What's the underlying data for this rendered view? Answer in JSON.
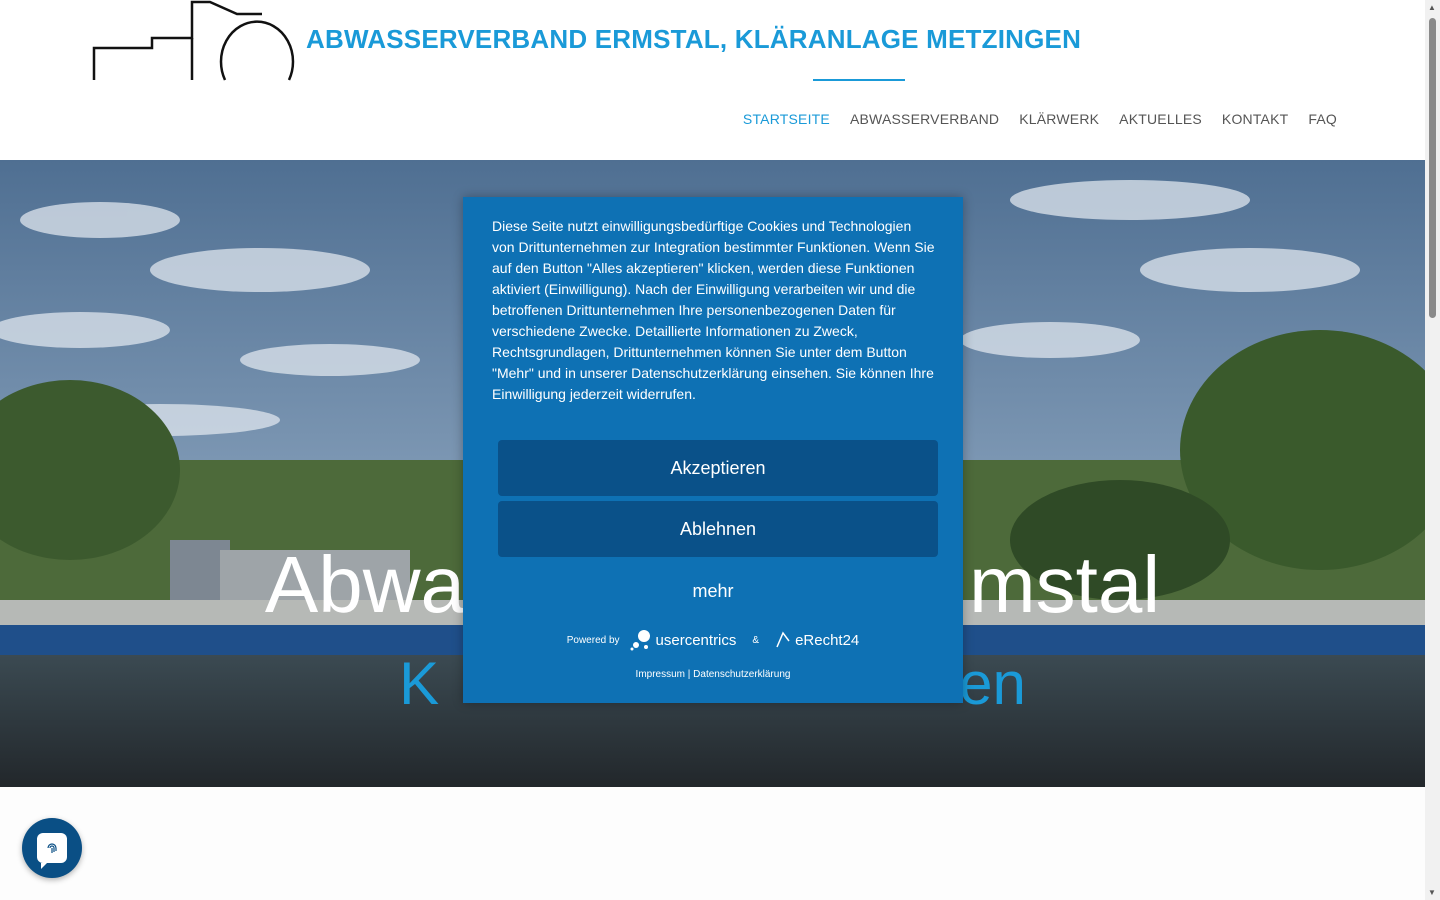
{
  "site": {
    "title": "ABWASSERVERBAND ERMSTAL, KLÄRANLAGE METZINGEN"
  },
  "nav": {
    "items": [
      {
        "label": "STARTSEITE",
        "active": true
      },
      {
        "label": "ABWASSERVERBAND",
        "active": false
      },
      {
        "label": "KLÄRWERK",
        "active": false
      },
      {
        "label": "AKTUELLES",
        "active": false
      },
      {
        "label": "KONTAKT",
        "active": false
      },
      {
        "label": "FAQ",
        "active": false
      }
    ]
  },
  "hero": {
    "title_left": "Abwa",
    "title_right": "mstal",
    "sub_left": "K",
    "sub_right": "en"
  },
  "cookie": {
    "text": "Diese Seite nutzt einwilligungsbedürftige Cookies und Technologien von Drittunternehmen zur Integration bestimmter Funktionen. Wenn Sie auf den Button \"Alles akzeptieren\" klicken, werden diese Funktionen aktiviert (Einwilligung). Nach der Einwilligung verarbeiten wir und die betroffenen Drittunternehmen Ihre personenbezogenen Daten für verschiedene Zwecke. Detaillierte Informationen zu Zweck, Rechtsgrundlagen, Drittunternehmen können Sie unter dem Button \"Mehr\" und in unserer Datenschutzerklärung einsehen. Sie können Ihre Einwilligung jederzeit widerrufen.",
    "accept_label": "Akzeptieren",
    "deny_label": "Ablehnen",
    "more_label": "mehr",
    "powered_by": "Powered by",
    "brand1": "usercentrics",
    "amp": "&",
    "brand2": "eRecht24",
    "impressum": "Impressum",
    "separator": "|",
    "privacy": "Datenschutzerklärung"
  },
  "colors": {
    "accent": "#1a9ad8",
    "dialog": "#0e71b4",
    "button": "#0a5189"
  }
}
